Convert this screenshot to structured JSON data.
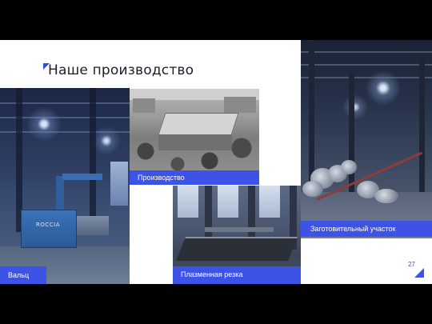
{
  "slide": {
    "title": "Наше производство",
    "page_number": "27",
    "accent_color": "#3c53e6"
  },
  "photos": [
    {
      "caption": "Вальц"
    },
    {
      "caption": "Производство"
    },
    {
      "caption": "Плазменная резка"
    },
    {
      "caption": "Заготовительный участок"
    }
  ],
  "machine_marking": "ROCCIA"
}
